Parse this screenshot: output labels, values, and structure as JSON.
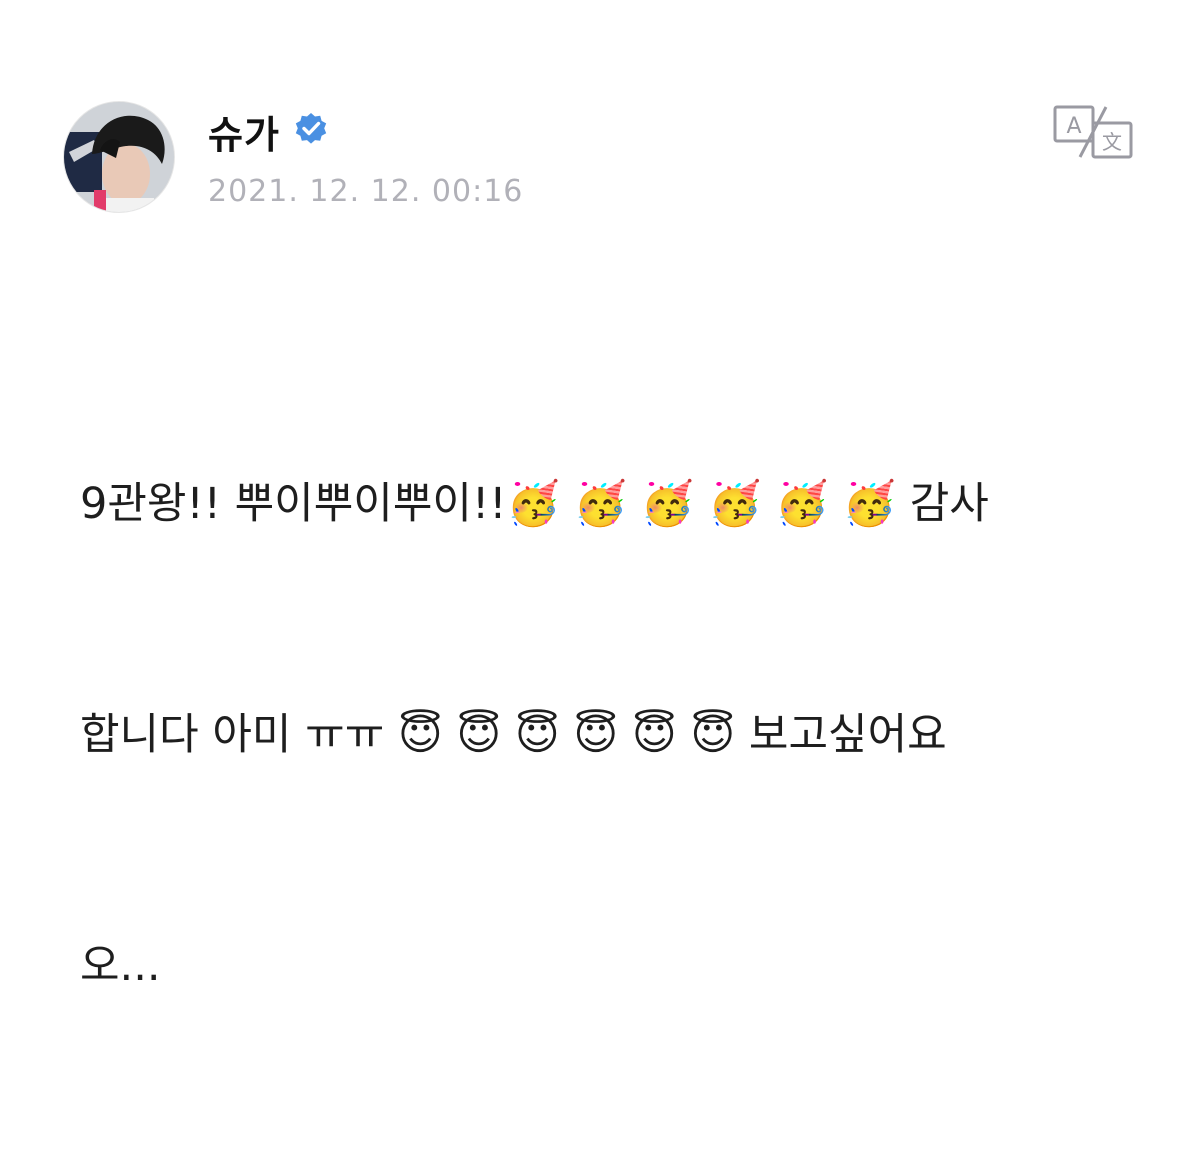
{
  "post": {
    "author": {
      "name": "슈가",
      "verified": true,
      "verified_badge_color": "#4a90e2"
    },
    "timestamp": "2021. 12. 12. 00:16",
    "translate_icon": "translate-icon",
    "body_lines": [
      "9관왕!! 뿌이뿌이뿌이!!🥳 🥳 🥳 🥳 🥳 🥳 감사",
      "합니다 아미 ㅠㅠ 😇 😇 😇 😇 😇 😇 보고싶어요",
      "오..."
    ]
  }
}
